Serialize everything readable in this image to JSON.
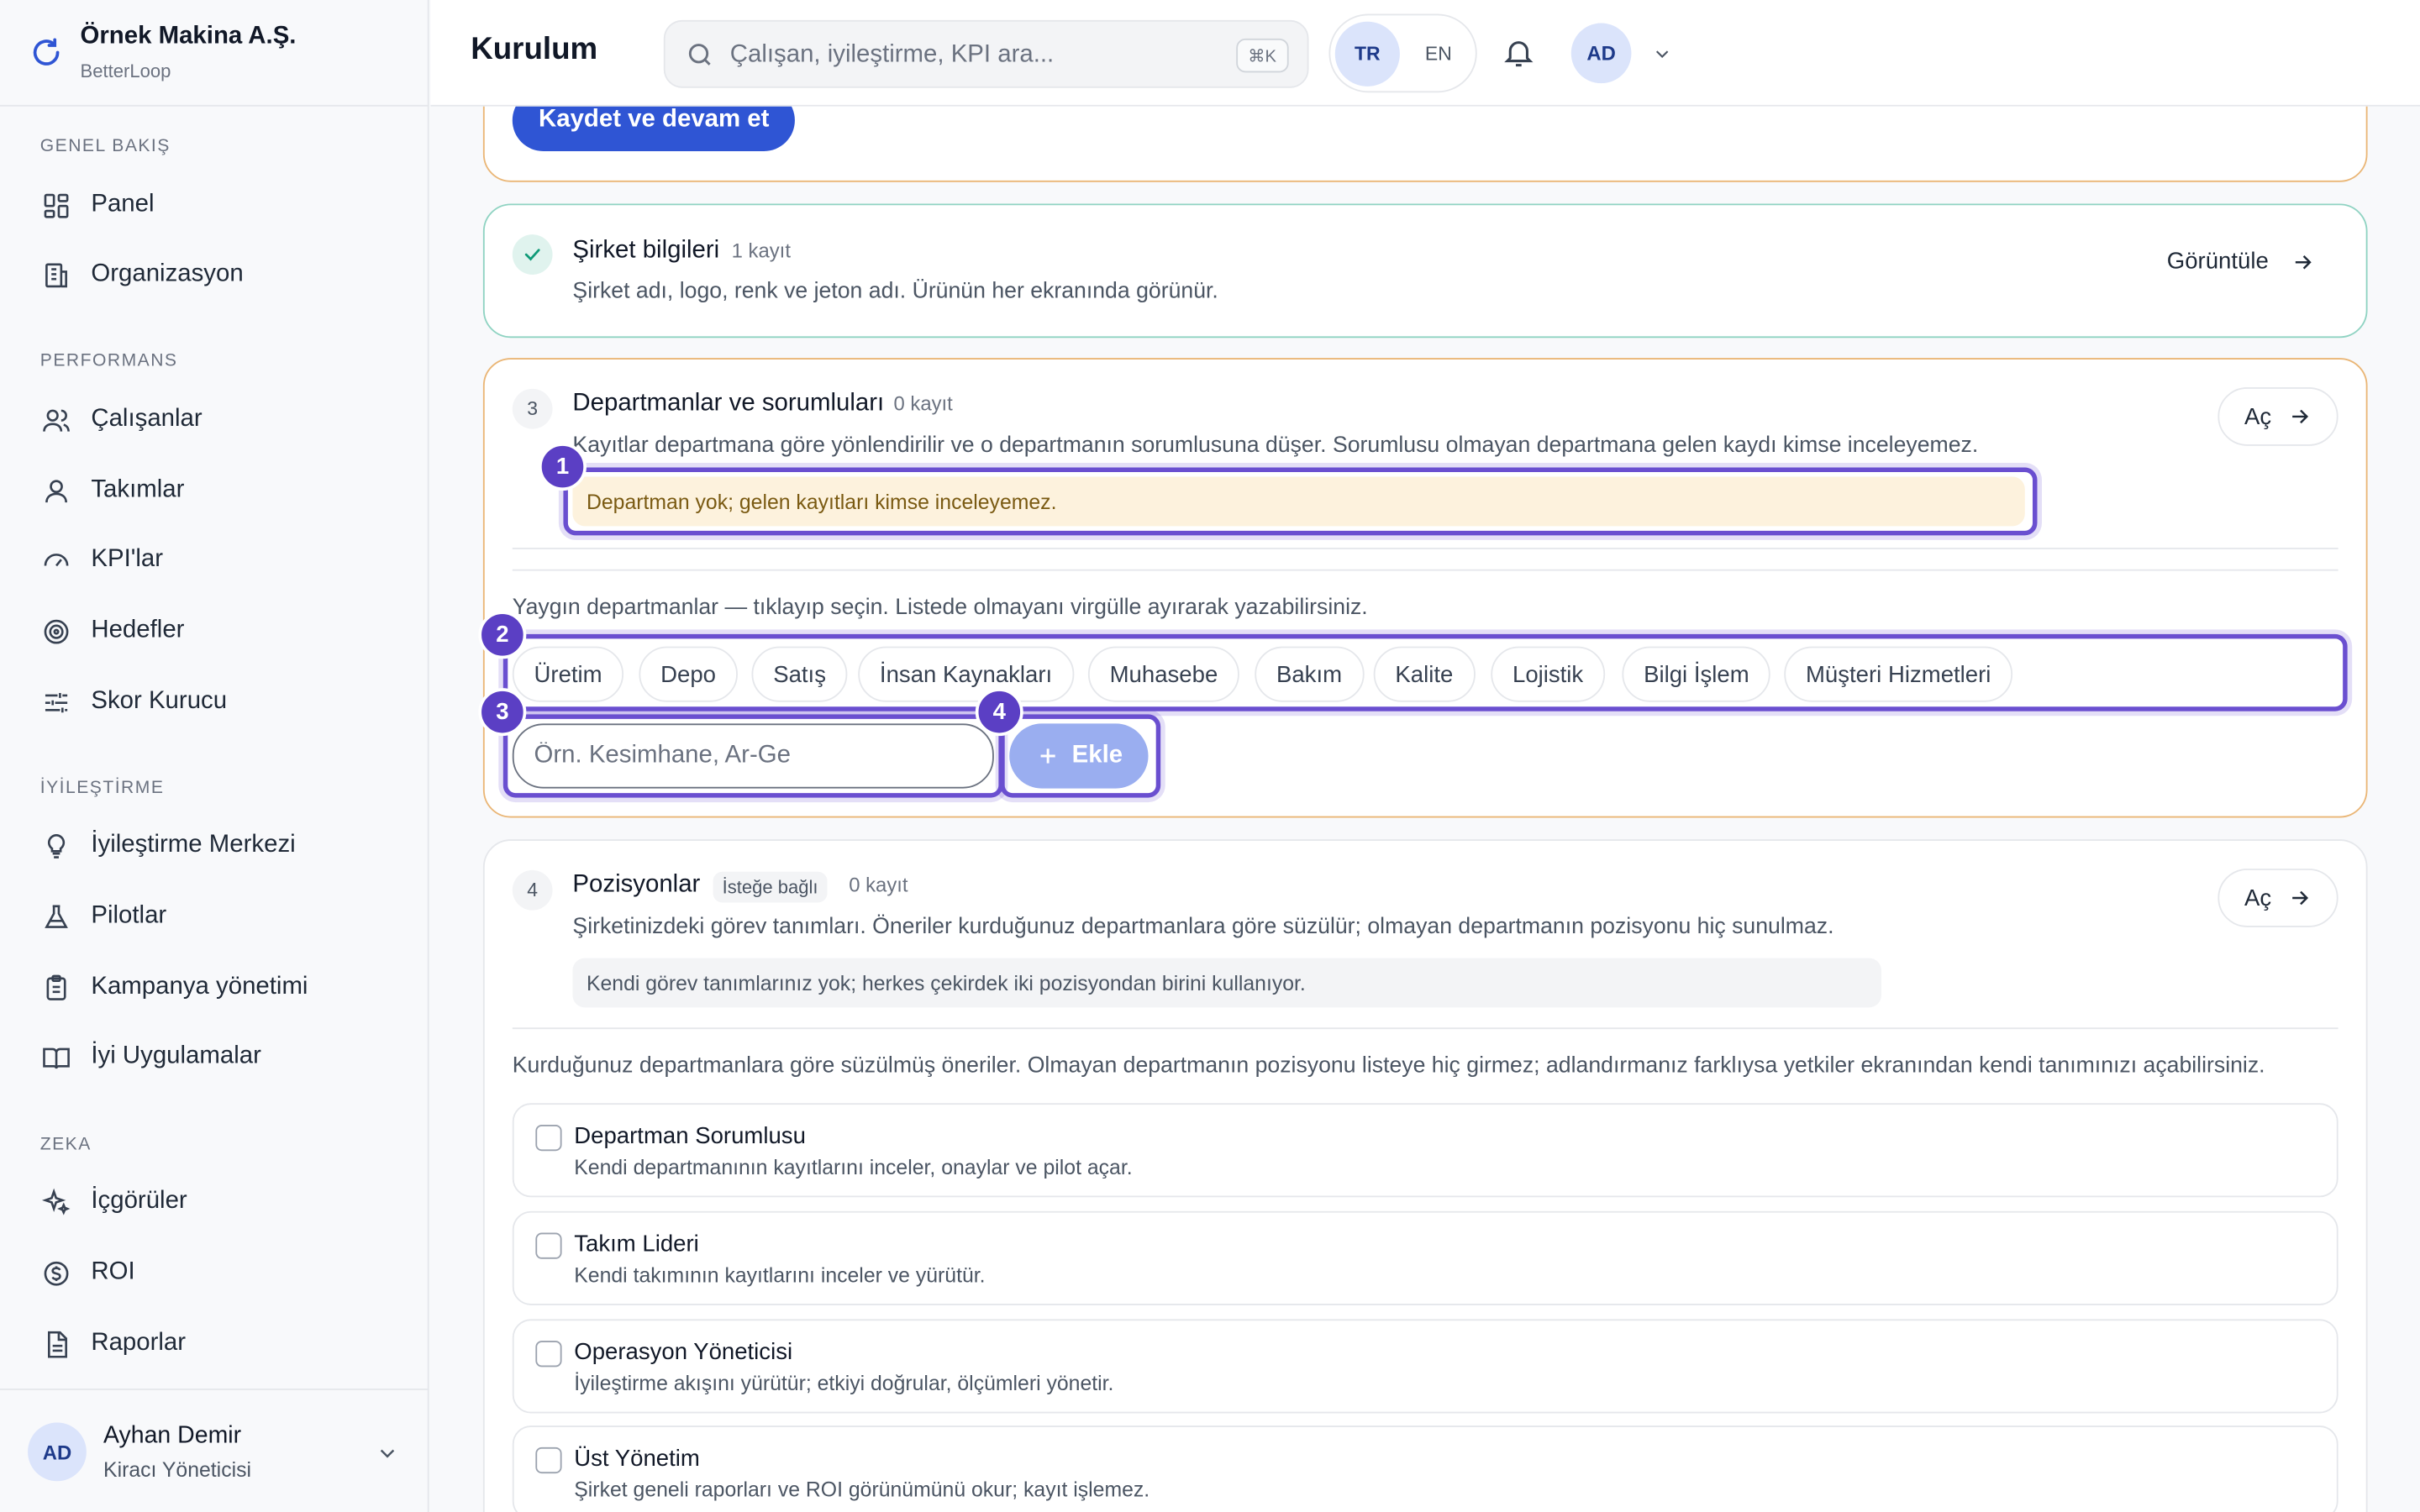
{
  "brand": {
    "name": "Örnek Makina A.Ş.",
    "sub": "BetterLoop"
  },
  "sidebar": {
    "sections": [
      {
        "label": "GENEL BAKIŞ",
        "items": [
          {
            "label": "Panel",
            "icon": "grid-icon"
          },
          {
            "label": "Organizasyon",
            "icon": "building-icon"
          }
        ]
      },
      {
        "label": "PERFORMANS",
        "items": [
          {
            "label": "Çalışanlar",
            "icon": "users-icon"
          },
          {
            "label": "Takımlar",
            "icon": "team-icon"
          },
          {
            "label": "KPI'lar",
            "icon": "gauge-icon"
          },
          {
            "label": "Hedefler",
            "icon": "target-icon"
          },
          {
            "label": "Skor Kurucu",
            "icon": "sliders-icon"
          }
        ]
      },
      {
        "label": "İYİLEŞTİRME",
        "items": [
          {
            "label": "İyileştirme Merkezi",
            "icon": "lightbulb-icon"
          },
          {
            "label": "Pilotlar",
            "icon": "flask-icon"
          },
          {
            "label": "Kampanya yönetimi",
            "icon": "clipboard-icon"
          },
          {
            "label": "İyi Uygulamalar",
            "icon": "book-icon"
          }
        ]
      },
      {
        "label": "ZEKA",
        "items": [
          {
            "label": "İçgörüler",
            "icon": "sparkles-icon"
          },
          {
            "label": "ROI",
            "icon": "dollar-icon"
          },
          {
            "label": "Raporlar",
            "icon": "report-icon"
          }
        ]
      }
    ],
    "user": {
      "initials": "AD",
      "name": "Ayhan Demir",
      "role": "Kiracı Yöneticisi"
    }
  },
  "header": {
    "title": "Kurulum",
    "search_placeholder": "Çalışan, iyileştirme, KPI ara...",
    "search_shortcut": "⌘K",
    "lang_active": "TR",
    "lang_other": "EN",
    "avatar_initials": "AD"
  },
  "main": {
    "save_button": "Kaydet ve devam et",
    "company": {
      "title": "Şirket bilgileri",
      "count": "1 kayıt",
      "desc": "Şirket adı, logo, renk ve jeton adı. Ürünün her ekranında görünür.",
      "action": "Görüntüle"
    },
    "departments": {
      "step": "3",
      "title": "Departmanlar ve sorumluları",
      "count": "0 kayıt",
      "desc": "Kayıtlar departmana göre yönlendirilir ve o departmanın sorumlusuna düşer. Sorumlusu olmayan departmana gelen kaydı kimse inceleyemez.",
      "warning": "Departman yok; gelen kayıtları kimse inceleyemez.",
      "action": "Aç",
      "hint": "Yaygın departmanlar — tıklayıp seçin. Listede olmayanı virgülle ayırarak yazabilirsiniz.",
      "chips": [
        "Üretim",
        "Depo",
        "Satış",
        "İnsan Kaynakları",
        "Muhasebe",
        "Bakım",
        "Kalite",
        "Lojistik",
        "Bilgi İşlem",
        "Müşteri Hizmetleri"
      ],
      "input_placeholder": "Örn. Kesimhane, Ar-Ge",
      "add_button": "Ekle"
    },
    "positions": {
      "step": "4",
      "title": "Pozisyonlar",
      "optional": "İsteğe bağlı",
      "count": "0 kayıt",
      "desc": "Şirketinizdeki görev tanımları. Öneriler kurduğunuz departmanlara göre süzülür; olmayan departmanın pozisyonu hiç sunulmaz.",
      "info": "Kendi görev tanımlarınız yok; herkes çekirdek iki pozisyondan birini kullanıyor.",
      "action": "Aç",
      "hint": "Kurduğunuz departmanlara göre süzülmüş öneriler. Olmayan departmanın pozisyonu listeye hiç girmez; adlandırmanız farklıysa yetkiler ekranından kendi tanımınızı açabilirsiniz.",
      "items": [
        {
          "title": "Departman Sorumlusu",
          "desc": "Kendi departmanının kayıtlarını inceler, onaylar ve pilot açar."
        },
        {
          "title": "Takım Lideri",
          "desc": "Kendi takımının kayıtlarını inceler ve yürütür."
        },
        {
          "title": "Operasyon Yöneticisi",
          "desc": "İyileştirme akışını yürütür; etkiyi doğrular, ölçümleri yönetir."
        },
        {
          "title": "Üst Yönetim",
          "desc": "Şirket geneli raporları ve ROI görünümünü okur; kayıt işlemez."
        }
      ]
    }
  },
  "annotations": {
    "badges": [
      "1",
      "2",
      "3",
      "4"
    ],
    "color": "#5b3fc4"
  },
  "colors": {
    "primary": "#2f55d4",
    "warning_bg": "#fdf2dd",
    "orange_border": "#eab676",
    "green_border": "#8fd3c2"
  }
}
